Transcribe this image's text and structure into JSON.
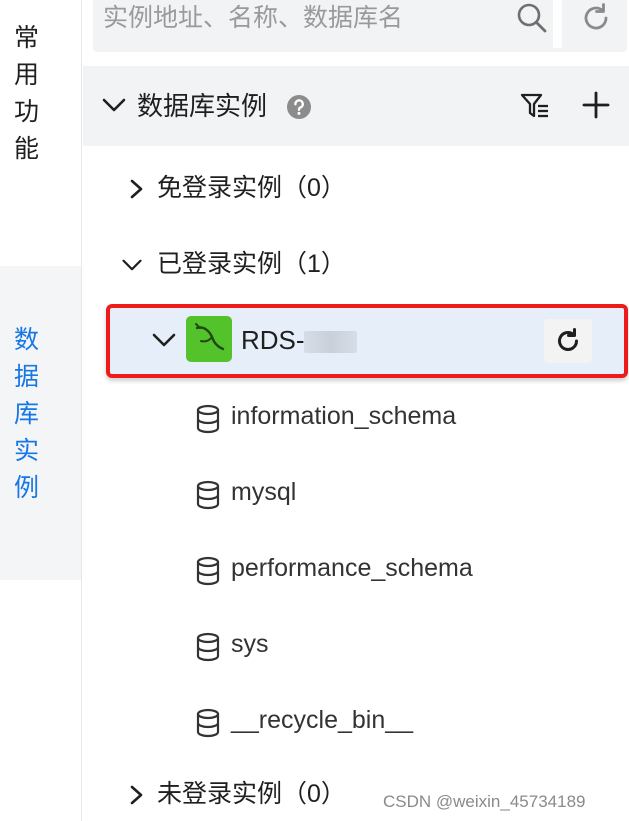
{
  "rail": {
    "common_tab": [
      "常",
      "用",
      "功",
      "能"
    ],
    "db_tab": [
      "数",
      "据",
      "库",
      "实",
      "例"
    ]
  },
  "search": {
    "placeholder": "实例地址、名称、数据库名"
  },
  "header": {
    "title": "数据库实例"
  },
  "groups": {
    "no_login": "免登录实例（0）",
    "logged_in": "已登录实例（1）",
    "not_logged_in": "未登录实例（0）"
  },
  "instance": {
    "name_prefix": "RDS-",
    "icon": "mysql-dolphin-icon",
    "icon_color": "#53c22b"
  },
  "databases": [
    "information_schema",
    "mysql",
    "performance_schema",
    "sys",
    "__recycle_bin__"
  ],
  "watermark": "CSDN @weixin_45734189",
  "colors": {
    "accent": "#1677e5",
    "highlight_border": "#ee1b1b",
    "selected_row": "#e6eef9"
  }
}
